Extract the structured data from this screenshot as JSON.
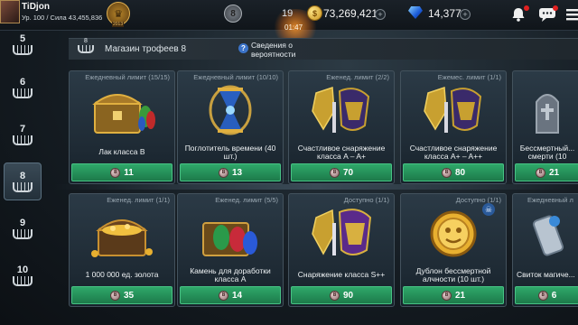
{
  "player": {
    "name": "TiDjon",
    "info": "Ур. 100 / Сила 43,455,836",
    "guild_tag": "2013"
  },
  "top": {
    "badge": "8",
    "count": "19",
    "timer": "01:47",
    "gold": "73,269,421",
    "gems": "14,377",
    "plus": "+"
  },
  "sidebar": {
    "tiers": [
      "5",
      "6",
      "7",
      "8",
      "9",
      "10"
    ],
    "active": "8"
  },
  "shop": {
    "tier": "8",
    "title": "Магазин трофеев 8",
    "probability": "Сведения о вероятности",
    "info_glyph": "?"
  },
  "items": [
    {
      "limit": "Ежедневный лимит (15/15)",
      "name": "Лак класса B",
      "price": "11"
    },
    {
      "limit": "Ежедневный лимит (10/10)",
      "name": "Поглотитель времени (40 шт.)",
      "price": "13"
    },
    {
      "limit": "Еженед. лимит (2/2)",
      "name": "Счастливое снаряжение класса A – A+",
      "price": "70"
    },
    {
      "limit": "Ежемес. лимит (1/1)",
      "name": "Счастливое снаряжение класса A+ – A++",
      "price": "80"
    },
    {
      "limit": "",
      "name": "Бессмертный... смерти (10",
      "price": "21"
    },
    {
      "limit": "Еженед. лимит (1/1)",
      "name": "1 000 000 ед. золота",
      "price": "35"
    },
    {
      "limit": "Еженед. лимит (5/5)",
      "name": "Камень для доработки класса A",
      "price": "14"
    },
    {
      "limit": "Доступно (1/1)",
      "name": "Снаряжение класса S++",
      "price": "90"
    },
    {
      "limit": "Доступно (1/1)",
      "name": "Дублон бессмертной алчности (10 шт.)",
      "price": "21"
    },
    {
      "limit": "Ежедневный л",
      "name": "Свиток магиче...",
      "price": "6"
    }
  ],
  "colors": {
    "buy_button": "#2fa86a",
    "card_bg": "#2b3a46",
    "accent_gold": "#c8901a"
  }
}
